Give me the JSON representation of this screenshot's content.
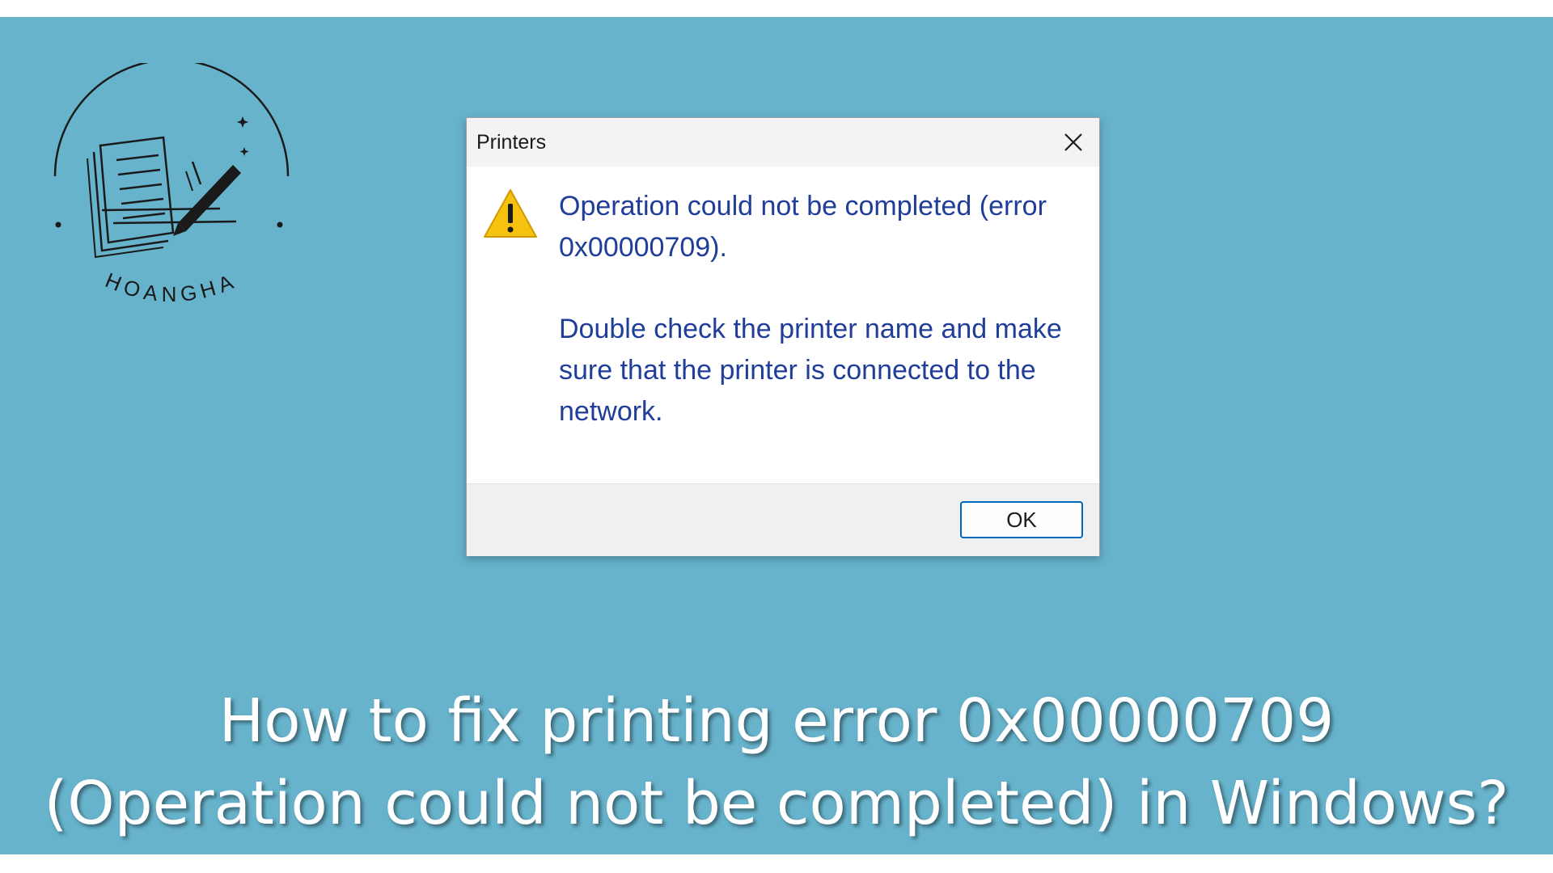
{
  "logo": {
    "brand": "HOANGHA",
    "icon": "notebook-pen-icon"
  },
  "dialog": {
    "title": "Printers",
    "close_icon": "close-icon",
    "warning_icon": "warning-icon",
    "message_line1": "Operation could not be completed (error 0x00000709).",
    "message_line2": "Double check the printer name and make sure that the printer is connected to the network.",
    "ok_label": "OK"
  },
  "caption": {
    "line1": "How to fix printing error 0x00000709",
    "line2": "(Operation could not be completed) in Windows?"
  },
  "colors": {
    "background": "#67b3cc",
    "message_text": "#1f3d99",
    "ok_border": "#0067c0",
    "warning_fill": "#f5c20f"
  }
}
